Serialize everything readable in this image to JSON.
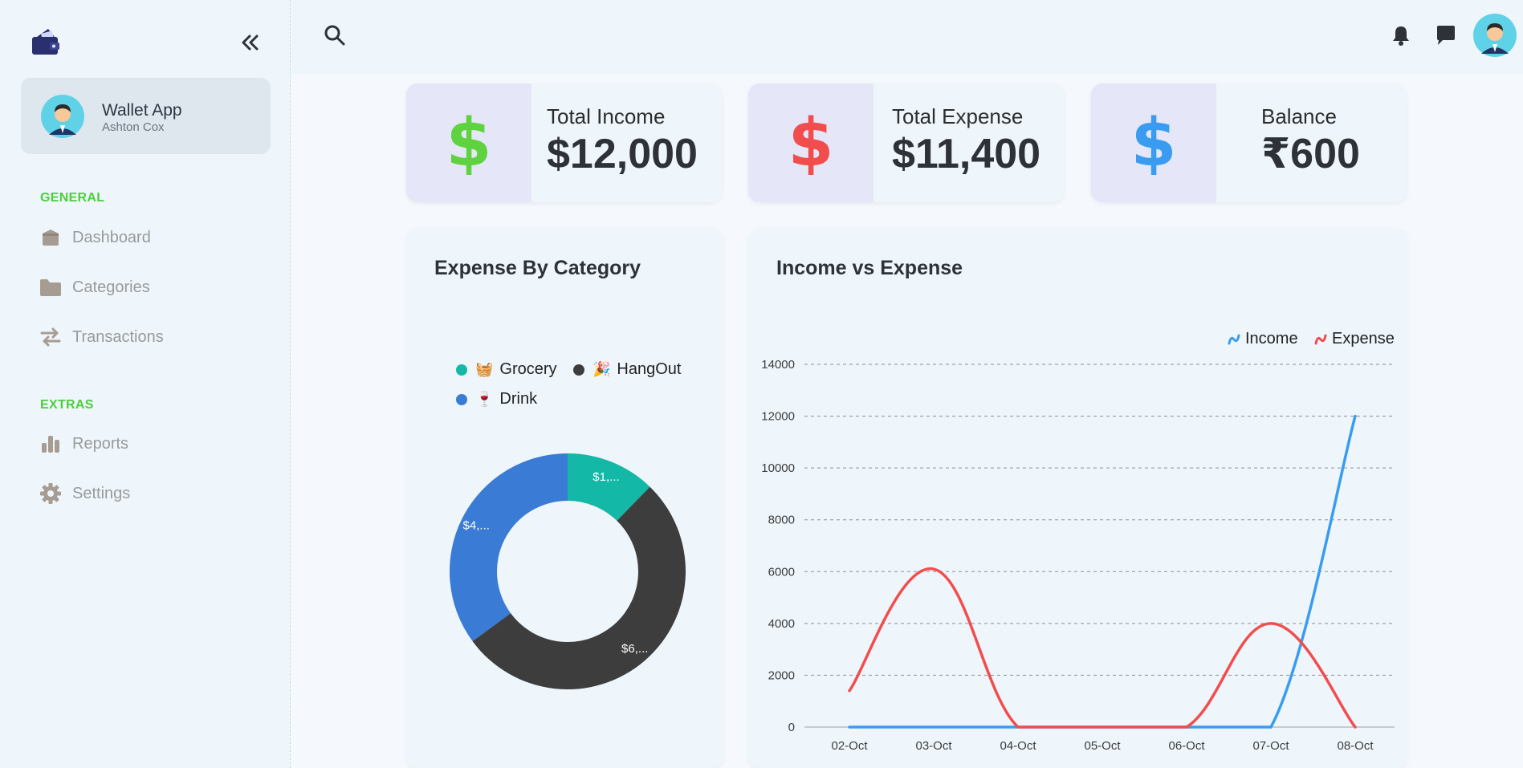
{
  "sidebar": {
    "profile": {
      "name": "Wallet App",
      "subtitle": "Ashton Cox"
    },
    "sections": [
      {
        "label": "GENERAL",
        "items": [
          {
            "label": "Dashboard",
            "icon": "box-icon"
          },
          {
            "label": "Categories",
            "icon": "folder-icon"
          },
          {
            "label": "Transactions",
            "icon": "swap-arrows-icon"
          }
        ]
      },
      {
        "label": "EXTRAS",
        "items": [
          {
            "label": "Reports",
            "icon": "bar-chart-icon"
          },
          {
            "label": "Settings",
            "icon": "gear-icon"
          }
        ]
      }
    ]
  },
  "stats": [
    {
      "label": "Total Income",
      "value": "$12,000",
      "symbol": "$",
      "color": "#5fd33f"
    },
    {
      "label": "Total Expense",
      "value": "$11,400",
      "symbol": "$",
      "color": "#f24d4d"
    },
    {
      "label": "Balance",
      "value": "₹600",
      "symbol": "$",
      "color": "#3a9cf0"
    }
  ],
  "expense_panel": {
    "title": "Expense By Category",
    "legend": [
      {
        "emoji": "🧺",
        "label": "Grocery",
        "color": "#14b8a6"
      },
      {
        "emoji": "🎉",
        "label": "HangOut",
        "color": "#3d3d3d"
      },
      {
        "emoji": "🍷",
        "label": "Drink",
        "color": "#3a7bd5"
      }
    ],
    "slice_labels": [
      "$1,...",
      "$6,...",
      "$4,..."
    ]
  },
  "income_panel": {
    "title": "Income vs Expense",
    "legend": [
      "Income",
      "Expense"
    ]
  },
  "chart_data": [
    {
      "type": "pie",
      "title": "Expense By Category",
      "categories": [
        "Grocery",
        "HangOut",
        "Drink"
      ],
      "values": [
        1400,
        6000,
        4000
      ],
      "colors": [
        "#14b8a6",
        "#3d3d3d",
        "#3a7bd5"
      ],
      "donut": true,
      "legend": "top"
    },
    {
      "type": "line",
      "title": "Income vs Expense",
      "categories": [
        "02-Oct",
        "03-Oct",
        "04-Oct",
        "05-Oct",
        "06-Oct",
        "07-Oct",
        "08-Oct"
      ],
      "series": [
        {
          "name": "Income",
          "color": "#3a9cf0",
          "values": [
            0,
            0,
            0,
            0,
            0,
            0,
            12000
          ]
        },
        {
          "name": "Expense",
          "color": "#f24d4d",
          "values": [
            1400,
            6100,
            0,
            0,
            0,
            4000,
            0
          ]
        }
      ],
      "y_ticks": [
        0,
        2000,
        4000,
        6000,
        8000,
        10000,
        12000,
        14000
      ],
      "ylim": [
        0,
        14000
      ],
      "grid": true,
      "legend": "top-right"
    }
  ]
}
